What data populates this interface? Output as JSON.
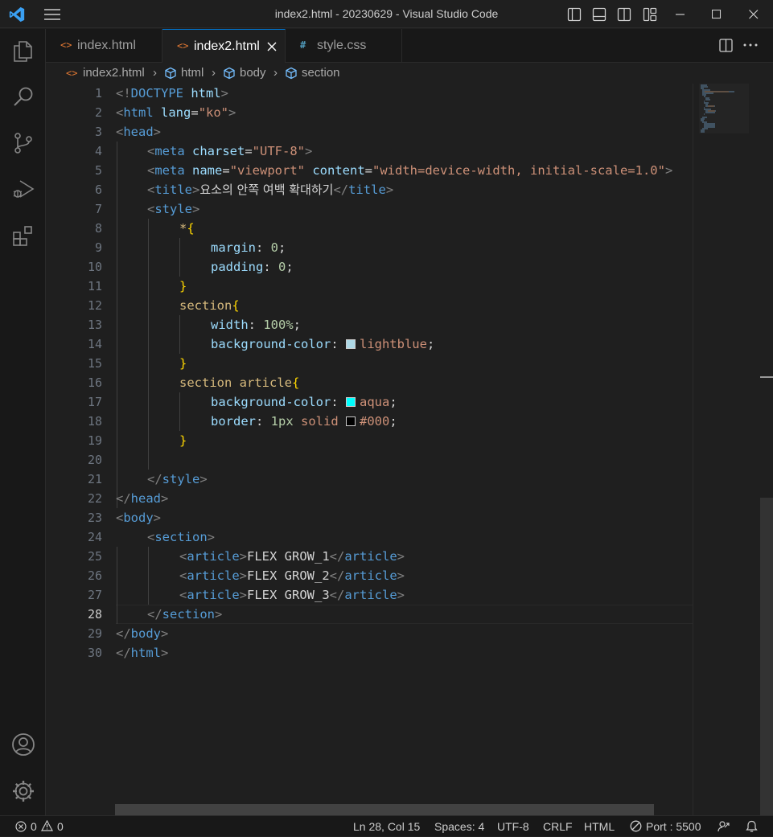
{
  "window": {
    "title": "index2.html - 20230629 - Visual Studio Code"
  },
  "tabs": [
    {
      "label": "index.html",
      "icon": "html-file-icon",
      "active": false
    },
    {
      "label": "index2.html",
      "icon": "html-file-icon",
      "active": true
    },
    {
      "label": "style.css",
      "icon": "css-file-icon",
      "active": false
    }
  ],
  "breadcrumb": [
    "index2.html",
    "html",
    "body",
    "section"
  ],
  "editor": {
    "current_line": 28,
    "line_numbers": [
      "1",
      "2",
      "3",
      "4",
      "5",
      "6",
      "7",
      "8",
      "9",
      "10",
      "11",
      "12",
      "13",
      "14",
      "15",
      "16",
      "17",
      "18",
      "19",
      "20",
      "21",
      "22",
      "23",
      "24",
      "25",
      "26",
      "27",
      "28",
      "29",
      "30"
    ],
    "swatches": {
      "lightblue": "#add8e6",
      "aqua": "#00ffff",
      "black": "#000000"
    },
    "code": {
      "l1": [
        "<!",
        "DOCTYPE",
        " html",
        ">"
      ],
      "l2": [
        "<",
        "html",
        " lang",
        "=",
        "\"ko\"",
        ">"
      ],
      "l3": [
        "<",
        "head",
        ">"
      ],
      "l4": [
        "<",
        "meta",
        " charset",
        "=",
        "\"UTF-8\"",
        ">"
      ],
      "l5": [
        "<",
        "meta",
        " name",
        "=",
        "\"viewport\"",
        " content",
        "=",
        "\"width=device-width, initial-scale=1.0\"",
        ">"
      ],
      "l6": [
        "<",
        "title",
        ">",
        "요소의 안쪽 여백 확대하기",
        "</",
        "title",
        ">"
      ],
      "l7": [
        "<",
        "style",
        ">"
      ],
      "l8": [
        "*",
        "{"
      ],
      "l9": [
        "margin",
        ": ",
        "0",
        ";"
      ],
      "l10": [
        "padding",
        ": ",
        "0",
        ";"
      ],
      "l11": [
        "}"
      ],
      "l12": [
        "section",
        "{"
      ],
      "l13": [
        "width",
        ": ",
        "100%",
        ";"
      ],
      "l14": [
        "background-color",
        ": ",
        "lightblue",
        ";"
      ],
      "l15": [
        "}"
      ],
      "l16": [
        "section article",
        "{"
      ],
      "l17": [
        "background-color",
        ": ",
        "aqua",
        ";"
      ],
      "l18": [
        "border",
        ": ",
        "1px",
        " solid ",
        "#000",
        ";"
      ],
      "l19": [
        "}"
      ],
      "l21": [
        "</",
        "style",
        ">"
      ],
      "l22": [
        "</",
        "head",
        ">"
      ],
      "l23": [
        "<",
        "body",
        ">"
      ],
      "l24": [
        "<",
        "section",
        ">"
      ],
      "l25": [
        "<",
        "article",
        ">",
        "FLEX GROW_1",
        "</",
        "article",
        ">"
      ],
      "l26": [
        "<",
        "article",
        ">",
        "FLEX GROW_2",
        "</",
        "article",
        ">"
      ],
      "l27": [
        "<",
        "article",
        ">",
        "FLEX GROW_3",
        "</",
        "article",
        ">"
      ],
      "l28": [
        "</",
        "section",
        ">"
      ],
      "l29": [
        "</",
        "body",
        ">"
      ],
      "l30": [
        "</",
        "html",
        ">"
      ]
    }
  },
  "statusbar": {
    "errors": "0",
    "warnings": "0",
    "position": "Ln 28, Col 15",
    "spaces": "Spaces: 4",
    "encoding": "UTF-8",
    "eol": "CRLF",
    "language": "HTML",
    "port": "Port : 5500"
  }
}
